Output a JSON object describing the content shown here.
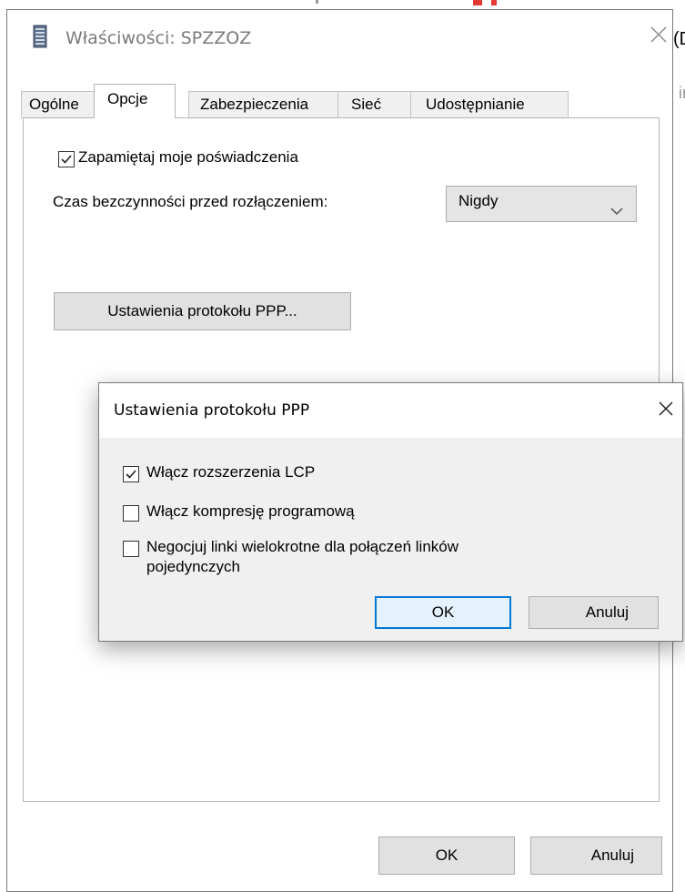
{
  "background": {
    "fragment_top": "(D",
    "fragment_mid": "ir"
  },
  "window": {
    "title": "Właściwości: SPZZOZ",
    "icons": {
      "app": "computer-tower-icon",
      "close": "close-icon"
    }
  },
  "tabs": [
    {
      "label": "Ogólne",
      "active": false
    },
    {
      "label": "Opcje",
      "active": true
    },
    {
      "label": "Zabezpieczenia",
      "active": false
    },
    {
      "label": "Sieć",
      "active": false
    },
    {
      "label": "Udostępnianie",
      "active": false
    }
  ],
  "options": {
    "remember_credentials": {
      "label": "Zapamiętaj moje poświadczenia",
      "checked": true
    },
    "idle_label": "Czas bezczynności przed rozłączeniem:",
    "idle_value": "Nigdy",
    "ppp_button": "Ustawienia protokołu PPP..."
  },
  "dialog": {
    "title": "Ustawienia protokołu PPP",
    "checkboxes": [
      {
        "label": "Włącz rozszerzenia LCP",
        "checked": true
      },
      {
        "label": "Włącz kompresję programową",
        "checked": false
      },
      {
        "label_line1": "Negocjuj linki wielokrotne dla połączeń linków",
        "label_line2": "pojedynczych",
        "checked": false
      }
    ],
    "ok": "OK",
    "cancel": "Anuluj"
  },
  "footer": {
    "ok": "OK",
    "cancel": "Anuluj"
  },
  "colors": {
    "accent": "#0078d7",
    "button_face": "#e1e1e1",
    "dialog_bg": "#f0f0f0"
  }
}
